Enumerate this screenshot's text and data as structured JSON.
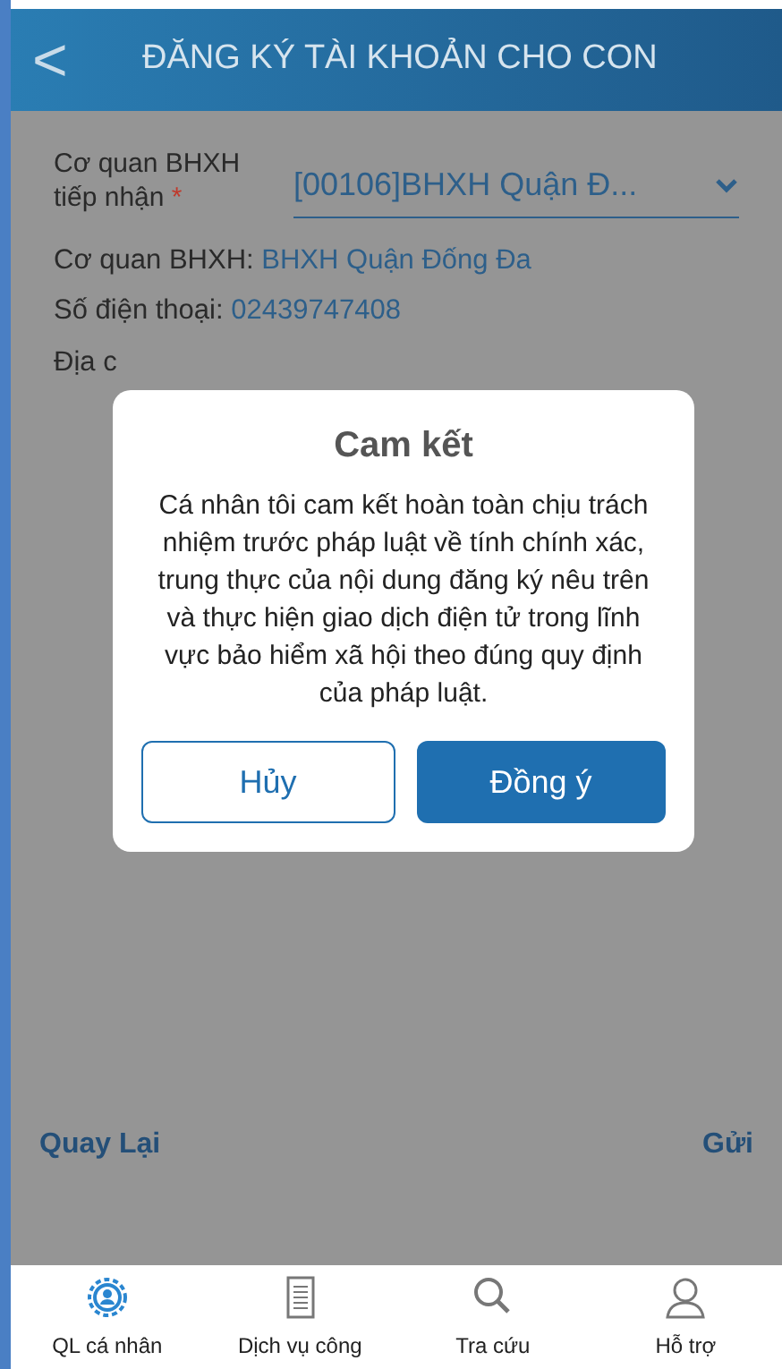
{
  "header": {
    "back": "<",
    "title": "ĐĂNG KÝ TÀI KHOẢN CHO CON"
  },
  "form": {
    "agency_label": "Cơ quan BHXH tiếp nhận",
    "required": "*",
    "agency_value": "[00106]BHXH Quận Đ...",
    "info": [
      {
        "label": "Cơ quan BHXH:",
        "value": "BHXH Quận Đống Đa"
      },
      {
        "label": "Số điện thoại:",
        "value": "02439747408"
      },
      {
        "label": "Địa c"
      }
    ]
  },
  "dialog": {
    "title": "Cam kết",
    "message": "Cá nhân tôi cam kết hoàn toàn chịu trách nhiệm trước pháp luật về tính chính xác, trung thực của nội dung đăng ký nêu trên và thực hiện giao dịch điện tử trong lĩnh vực bảo hiểm xã hội theo đúng quy định của pháp luật.",
    "buttons": [
      {
        "label": "Hủy",
        "kind": "outline"
      },
      {
        "label": "Đồng ý",
        "kind": "primary"
      }
    ]
  },
  "actions": {
    "back": "Quay Lại",
    "submit": "Gửi"
  },
  "tabs": [
    {
      "label": "QL cá nhân",
      "selected": true
    },
    {
      "label": "Dịch vụ công",
      "selected": false
    },
    {
      "label": "Tra cứu",
      "selected": false
    },
    {
      "label": "Hỗ trợ",
      "selected": false
    }
  ]
}
